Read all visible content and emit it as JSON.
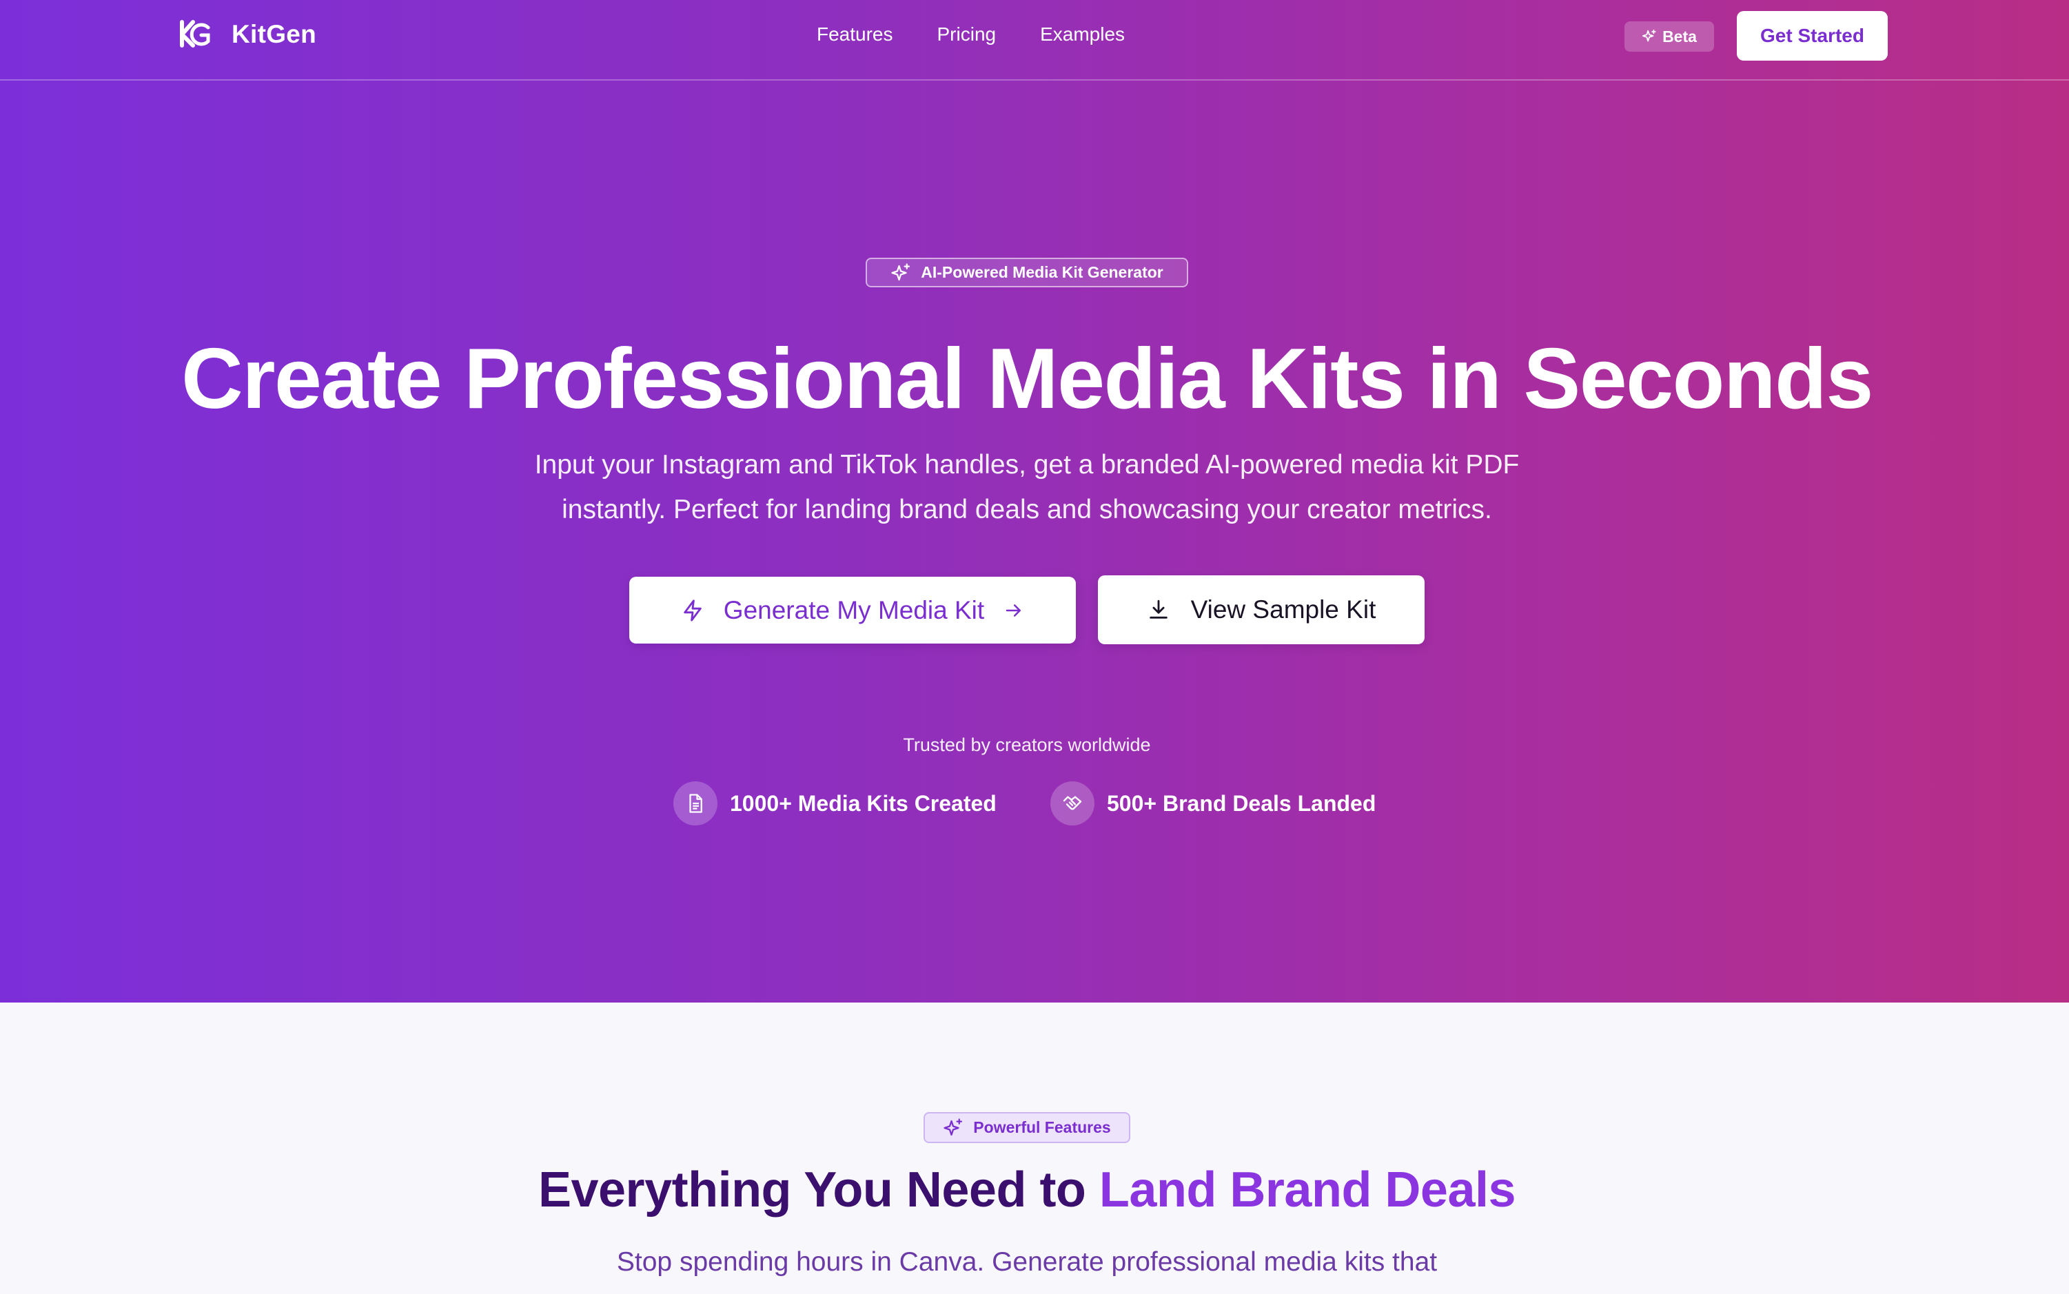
{
  "nav": {
    "brand": "KitGen",
    "links": [
      "Features",
      "Pricing",
      "Examples"
    ],
    "beta_label": "Beta",
    "cta_label": "Get Started"
  },
  "hero": {
    "badge": "AI-Powered Media Kit Generator",
    "headline": "Create Professional Media Kits in Seconds",
    "subline_1": "Input your Instagram and TikTok handles, get a branded AI-powered media kit PDF",
    "subline_2": "instantly. Perfect for landing brand deals and showcasing your creator metrics.",
    "primary_cta": "Generate My Media Kit",
    "secondary_cta": "View Sample Kit",
    "trusted": "Trusted by creators worldwide",
    "stats": [
      "1000+ Media Kits Created",
      "500+ Brand Deals Landed"
    ]
  },
  "features": {
    "badge": "Powerful Features",
    "title_prefix": "Everything You Need to",
    "title_accent": "Land Brand Deals",
    "subtitle": "Stop spending hours in Canva. Generate professional media kits that"
  },
  "colors": {
    "gradient_start": "#7c2fd9",
    "gradient_end": "#b82d86",
    "accent": "#7a2ecf",
    "heading_dark": "#3b0f6e"
  },
  "icons": [
    "kitgen-logo",
    "sparkles-icon",
    "lightning-icon",
    "arrow-right-icon",
    "download-icon",
    "document-icon",
    "handshake-icon"
  ]
}
